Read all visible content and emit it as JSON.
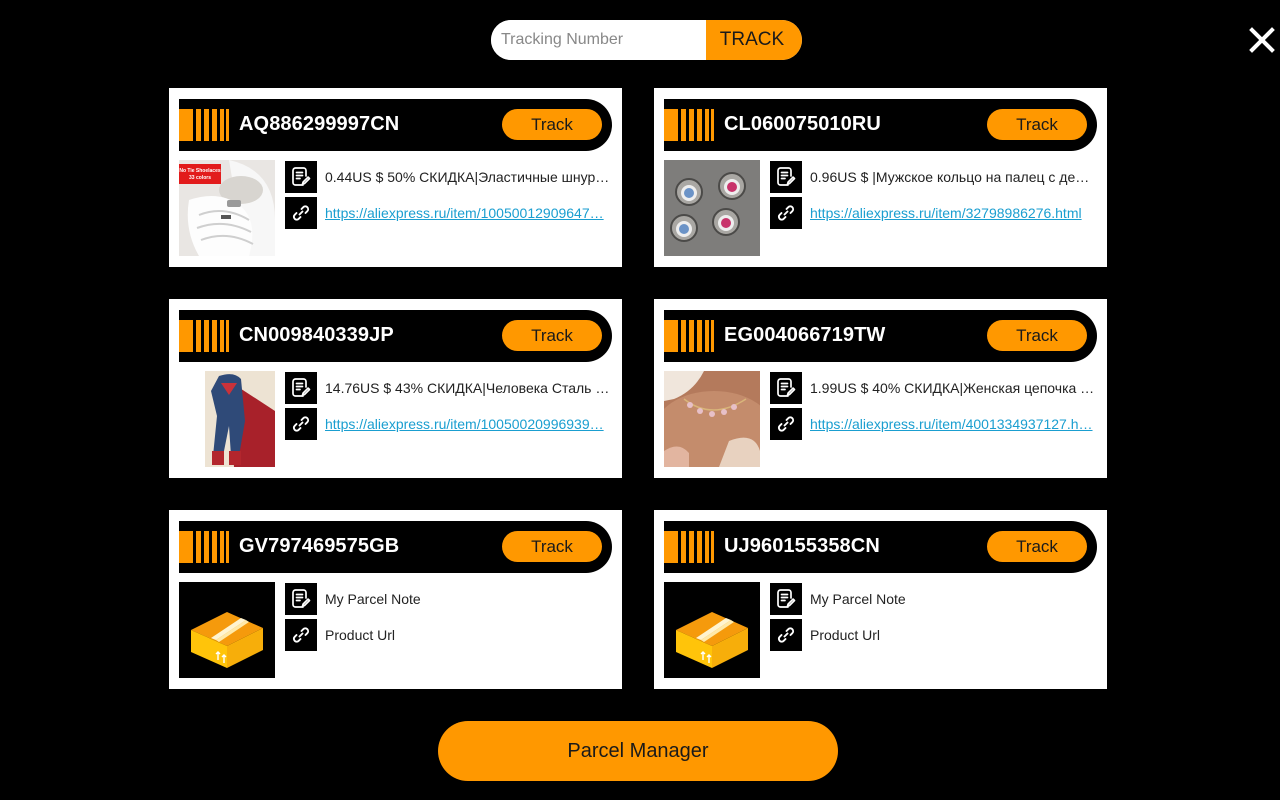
{
  "search": {
    "placeholder": "Tracking Number",
    "value": "",
    "button_label": "TRACK"
  },
  "close_icon": "close-icon",
  "colors": {
    "accent": "#ff9800",
    "background": "#000000",
    "link": "#1a9ed0"
  },
  "parcels": [
    {
      "tracking_number": "AQ886299997CN",
      "track_label": "Track",
      "note": "0.44US $ 50% СКИДКА|Эластичные шнур…",
      "url": "https://aliexpress.ru/item/10050012909647…",
      "image": "shoelaces-photo",
      "image_caption": "No Tie Shoelaces 33 colors",
      "url_is_link": true
    },
    {
      "tracking_number": "CL060075010RU",
      "track_label": "Track",
      "note": "0.96US $ |Мужское кольцо на палец с де…",
      "url": "https://aliexpress.ru/item/32798986276.html",
      "image": "eyeball-rings-photo",
      "url_is_link": true
    },
    {
      "tracking_number": "CN009840339JP",
      "track_label": "Track",
      "note": "14.76US $ 43% СКИДКА|Человека Сталь …",
      "url": "https://aliexpress.ru/item/10050020996939…",
      "image": "superman-costume-photo",
      "url_is_link": true
    },
    {
      "tracking_number": "EG004066719TW",
      "track_label": "Track",
      "note": "1.99US $ 40% СКИДКА|Женская цепочка …",
      "url": "https://aliexpress.ru/item/4001334937127.h…",
      "image": "butterfly-necklace-photo",
      "url_is_link": true
    },
    {
      "tracking_number": "GV797469575GB",
      "track_label": "Track",
      "note": "My Parcel Note",
      "url": "Product Url",
      "image": "package-icon",
      "url_is_link": false
    },
    {
      "tracking_number": "UJ960155358CN",
      "track_label": "Track",
      "note": "My Parcel Note",
      "url": "Product Url",
      "image": "package-icon",
      "url_is_link": false
    }
  ],
  "footer": {
    "parcel_manager_label": "Parcel Manager"
  }
}
